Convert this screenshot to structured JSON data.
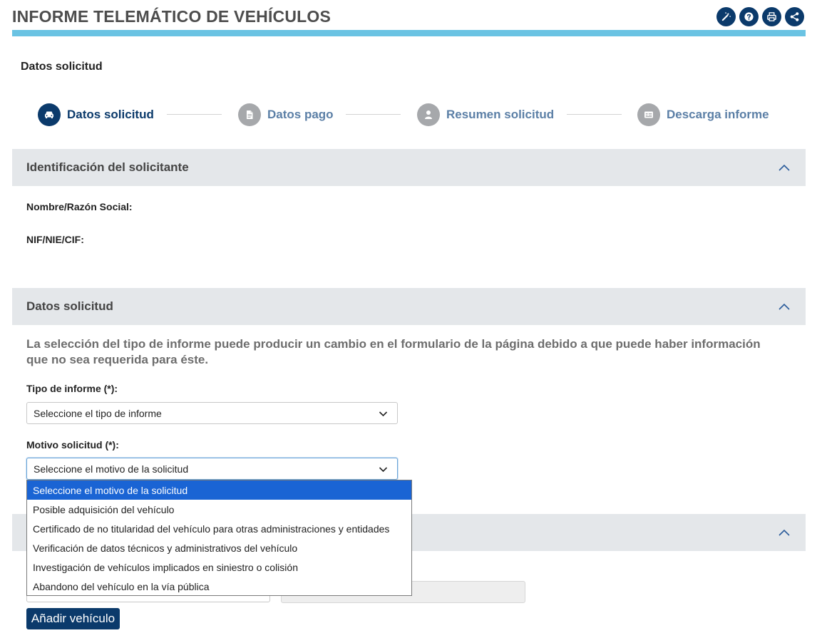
{
  "header": {
    "title": "INFORME TELEMÁTICO DE VEHÍCULOS",
    "icons": [
      "wand-icon",
      "help-icon",
      "print-icon",
      "share-icon"
    ]
  },
  "section_heading": "Datos solicitud",
  "stepper": {
    "steps": [
      {
        "label": "Datos solicitud",
        "state": "active",
        "icon": "car-icon"
      },
      {
        "label": "Datos pago",
        "state": "inactive",
        "icon": "document-icon"
      },
      {
        "label": "Resumen solicitud",
        "state": "inactive",
        "icon": "user-icon"
      },
      {
        "label": "Descarga informe",
        "state": "inactive",
        "icon": "card-icon"
      }
    ]
  },
  "identification_panel": {
    "title": "Identificación del solicitante",
    "name_label": "Nombre/Razón Social:",
    "nif_label": "NIF/NIE/CIF:"
  },
  "request_panel": {
    "title": "Datos solicitud",
    "info_text": "La selección del tipo de informe puede producir un cambio en el formulario de la página debido a que puede haber información que no sea requerida para éste.",
    "report_type_label": "Tipo de informe (*):",
    "report_type_value": "Seleccione el tipo de informe",
    "reason_label": "Motivo solicitud (*):",
    "reason_value": "Seleccione el motivo de la solicitud",
    "reason_options": [
      "Seleccione el motivo de la solicitud",
      "Posible adquisición del vehículo",
      "Certificado de no titularidad del vehículo para otras administraciones y entidades",
      "Verificación de datos técnicos y administrativos del vehículo",
      "Investigación de vehículos implicados en siniestro o colisión",
      "Abandono del vehículo en la vía pública"
    ],
    "selected_option_index": 0
  },
  "vehicle_panel": {
    "add_button_label": "Añadir vehículo"
  },
  "colors": {
    "primary": "#0b3a6b",
    "header_bar": "#6ac3e3",
    "panel_bg": "#e4e7ea",
    "selected_option": "#1a64d4",
    "inactive_step": "#a6a8ab"
  }
}
